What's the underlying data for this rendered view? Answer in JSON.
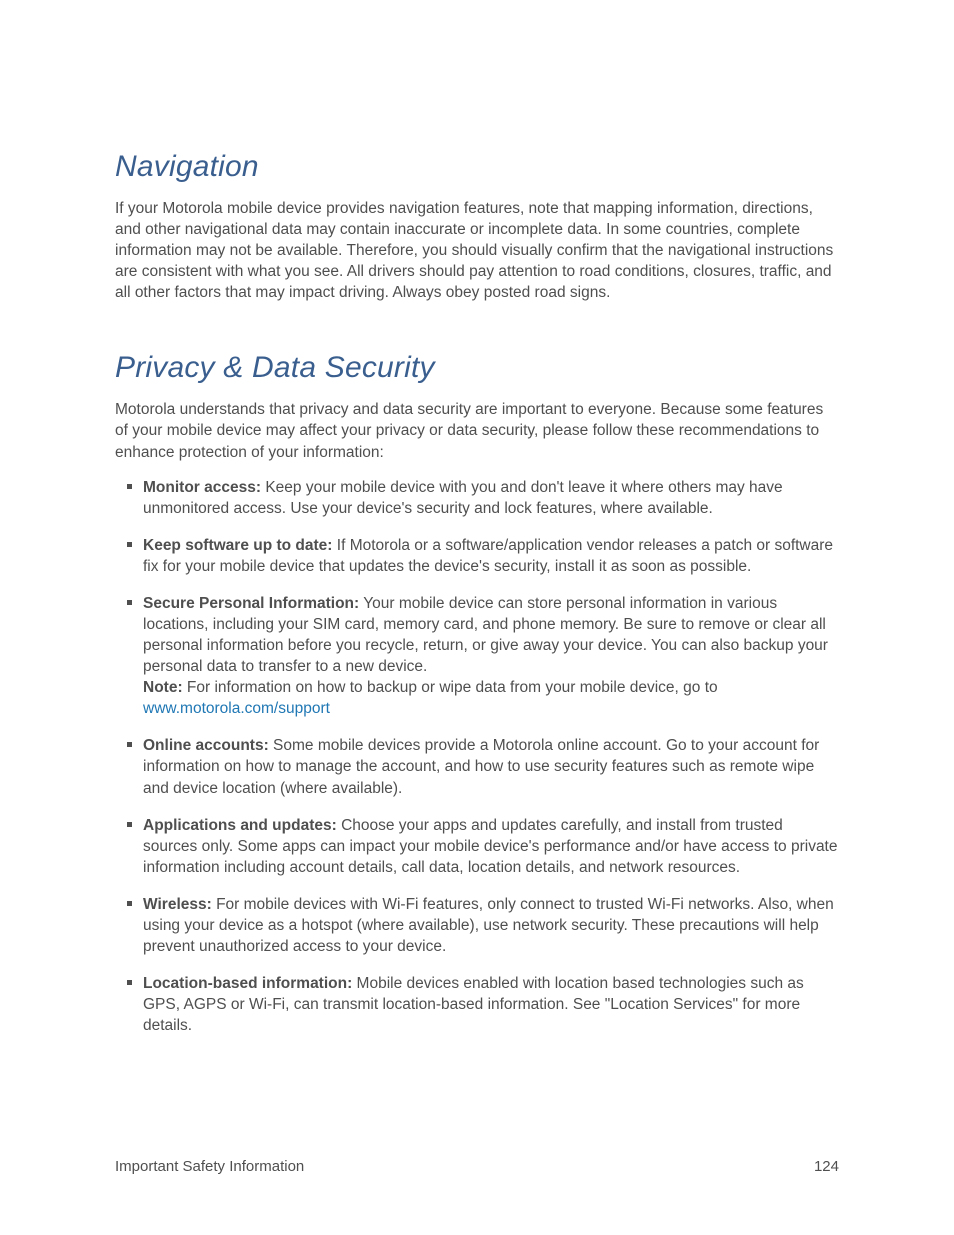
{
  "sections": {
    "navigation": {
      "heading": "Navigation",
      "body": "If your Motorola mobile device provides navigation features, note that mapping information, directions, and other navigational data may contain inaccurate or incomplete data. In some countries, complete information may not be available. Therefore, you should visually confirm that the navigational instructions are consistent with what you see. All drivers should pay attention to road conditions, closures, traffic, and all other factors that may impact driving. Always obey posted road signs."
    },
    "privacy": {
      "heading": "Privacy & Data Security",
      "intro": "Motorola understands that privacy and data security are important to everyone. Because some features of your mobile device may affect your privacy or data security, please follow these recommendations to enhance protection of your information:",
      "items": [
        {
          "lead": "Monitor access:",
          "text": "  Keep your mobile device with you and don't leave it where others may have unmonitored access. Use your device's security and lock features, where available."
        },
        {
          "lead": "Keep software up to date:",
          "text": "  If Motorola or a software/application vendor releases a patch or software fix for your mobile device that updates the device's security, install it as soon as possible."
        },
        {
          "lead": "Secure Personal Information:",
          "text": "  Your mobile device can store personal information in various locations, including your SIM card, memory card, and phone memory. Be sure to remove or clear all personal information before you recycle, return, or give away your device. You can also backup your personal data to transfer to a new device.",
          "note_label": " Note:",
          "note_text": "  For information on how to backup or wipe data from your mobile device, go to ",
          "link_text": "www.motorola.com/support"
        },
        {
          "lead": "Online accounts:",
          "text": "  Some mobile devices provide a Motorola online account. Go to your account for information on how to manage the account, and how to use security features such as remote wipe and device location (where available)."
        },
        {
          "lead": "Applications and updates:",
          "text": "  Choose your apps and updates carefully, and install from trusted sources only. Some apps can impact your mobile device's performance and/or have access to private information including account details, call data, location details, and network resources."
        },
        {
          "lead": "Wireless:",
          "text": "  For mobile devices with Wi-Fi features, only connect to trusted Wi-Fi networks. Also, when using your device as a hotspot (where available), use network security. These precautions will help prevent unauthorized access to your device."
        },
        {
          "lead": "Location-based information:",
          "text": "  Mobile devices enabled with location based technologies such as GPS, AGPS or Wi-Fi, can transmit location-based information. See \"Location Services\" for more details."
        }
      ]
    }
  },
  "footer": {
    "left": "Important Safety Information",
    "right": "124"
  }
}
